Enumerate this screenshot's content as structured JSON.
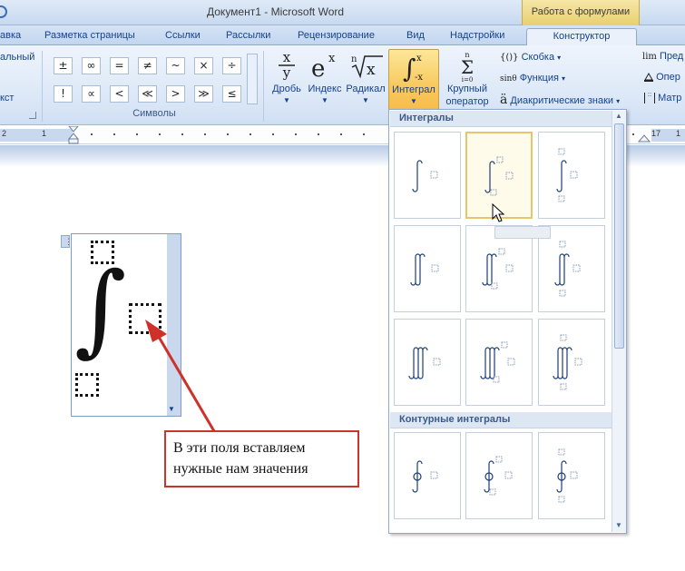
{
  "window": {
    "title": "Документ1 - Microsoft Word",
    "context_tab_group": "Работа с формулами"
  },
  "tabs": [
    {
      "label": "авка",
      "active": false
    },
    {
      "label": "Разметка страницы",
      "active": false
    },
    {
      "label": "Ссылки",
      "active": false
    },
    {
      "label": "Рассылки",
      "active": false
    },
    {
      "label": "Рецензирование",
      "active": false
    },
    {
      "label": "Вид",
      "active": false
    },
    {
      "label": "Надстройки",
      "active": false
    },
    {
      "label": "Конструктор",
      "active": true
    }
  ],
  "ribbon": {
    "left_partial": {
      "line1": "альный",
      "line2": "кст"
    },
    "symbols_group_label": "Символы",
    "symbols": [
      "±",
      "∞",
      "=",
      "≠",
      "~",
      "×",
      "÷",
      "!",
      "∝",
      "<",
      "≪",
      ">",
      "≫",
      "≤"
    ],
    "structures": [
      {
        "label": "Дробь",
        "glyph": "x/y"
      },
      {
        "label": "Индекс",
        "glyph": "eˣ"
      },
      {
        "label": "Радикал",
        "glyph": "ⁿ√x"
      },
      {
        "label": "Интеграл",
        "glyph": "∫ˣ₋ₓ",
        "active": true
      },
      {
        "label": "Крупный оператор",
        "line1": "Крупный",
        "line2": "оператор",
        "glyph": "Σ"
      }
    ],
    "small_buttons": [
      {
        "label": "Скобка",
        "icon": "{()}"
      },
      {
        "label": "Функция",
        "icon": "sinθ"
      },
      {
        "label": "Диакритические знаки",
        "icon": "ä"
      }
    ],
    "right_partial": [
      {
        "label": "Пред",
        "icon": "lim"
      },
      {
        "label": "Опер",
        "icon": "triangle-underline-icon"
      },
      {
        "label": "Матр",
        "icon": "matrix-icon"
      }
    ]
  },
  "ruler": {
    "left_numbers": [
      "2",
      "1"
    ],
    "right_numbers": [
      "17",
      "1"
    ]
  },
  "gallery": {
    "sections": [
      {
        "title": "Интегралы",
        "items": [
          {
            "name": "integral",
            "signs": 1,
            "limits": "none"
          },
          {
            "name": "integral-with-subsup-limits",
            "signs": 1,
            "limits": "subsup",
            "hover": true
          },
          {
            "name": "integral-with-over-under-limits",
            "signs": 1,
            "limits": "overunder"
          },
          {
            "name": "double-integral",
            "signs": 2,
            "limits": "none"
          },
          {
            "name": "double-integral-with-subsup-limits",
            "signs": 2,
            "limits": "subsup"
          },
          {
            "name": "double-integral-with-over-under-limits",
            "signs": 2,
            "limits": "overunder"
          },
          {
            "name": "triple-integral",
            "signs": 3,
            "limits": "none"
          },
          {
            "name": "triple-integral-with-subsup-limits",
            "signs": 3,
            "limits": "subsup"
          },
          {
            "name": "triple-integral-with-over-under-limits",
            "signs": 3,
            "limits": "overunder"
          }
        ]
      },
      {
        "title": "Контурные интегралы",
        "items": [
          {
            "name": "contour-integral",
            "signs": 1,
            "limits": "none",
            "contour": true
          },
          {
            "name": "contour-integral-with-subsup-limits",
            "signs": 1,
            "limits": "subsup",
            "contour": true
          },
          {
            "name": "contour-integral-with-over-under-limits",
            "signs": 1,
            "limits": "overunder",
            "contour": true
          }
        ]
      }
    ]
  },
  "equation": {
    "symbol": "∫"
  },
  "callout": {
    "line1": "В эти поля вставляем",
    "line2": "нужные нам значения",
    "border_color": "#c9342d"
  },
  "colors": {
    "accent": "#15428b",
    "active_button": "#f8c85c",
    "arrow": "#d0302a"
  }
}
